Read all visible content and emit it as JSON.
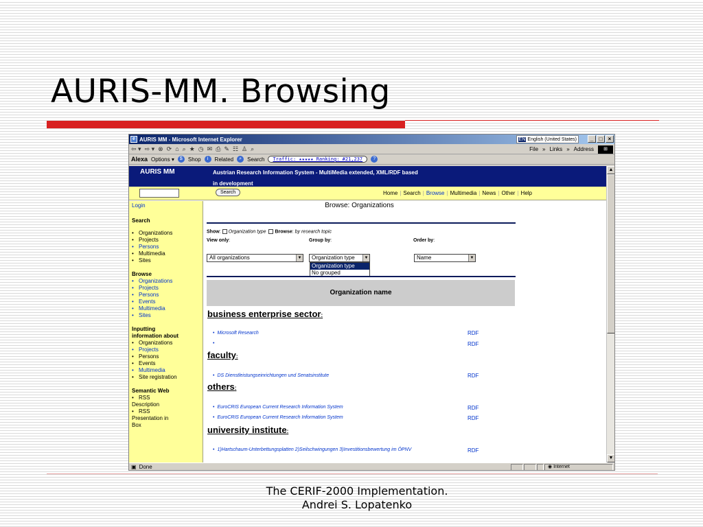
{
  "slide": {
    "title": "AURIS-MM. Browsing",
    "footer_line1": "The CERIF-2000 Implementation.",
    "footer_line2": "Andrei S. Lopatenko"
  },
  "browser": {
    "window_title": "AURIS MM - Microsoft Internet Explorer",
    "language": "English (United States)",
    "language_code": "EN",
    "menu": {
      "file": "File",
      "links": "Links",
      "address": "Address"
    },
    "alexa": {
      "logo": "Alexa",
      "options": "Options",
      "shop": "Shop",
      "related": "Related",
      "search": "Search",
      "traffic": "Traffic: ★★★★★ Ranking: #21,237"
    },
    "status": {
      "text": "Done",
      "zone": "Internet"
    }
  },
  "site": {
    "logo": "AURIS MM",
    "tagline_line1": "Austrian Research Information System - MultiMedia extended, XML/RDF based",
    "tagline_line2": "in development",
    "search_button": "Search",
    "nav_links": [
      "Home",
      "Search",
      "Browse",
      "Multimedia",
      "News",
      "Other",
      "Help"
    ]
  },
  "sidebar": {
    "login": "Login",
    "search_head": "Search",
    "search_items": [
      "Organizations",
      "Projects",
      "Persons",
      "Multimedia",
      "Sites"
    ],
    "browse_head": "Browse",
    "browse_items": [
      "Organizations",
      "Projects",
      "Persons",
      "Events",
      "Multimedia",
      "Sites"
    ],
    "inputting_head_line1": "Inputting",
    "inputting_head_line2": "information about",
    "inputting_items": [
      "Organizations",
      "Projects",
      "Persons",
      "Events",
      "Multimedia",
      "Site registration"
    ],
    "semantic_head": "Semantic Web",
    "semantic_item1_line1": "RSS",
    "semantic_item1_line2": "Description",
    "semantic_item2_line1": "RSS",
    "semantic_item2_line2": "Presentation in",
    "semantic_item2_line3": "Box"
  },
  "main": {
    "title": "Browse: Organizations",
    "show_label": "Show",
    "show_option": "Organization type",
    "browse_label": "Browse",
    "browse_option": "by research topic",
    "view_only_label": "View only",
    "group_by_label": "Group by",
    "order_by_label": "Order by",
    "view_only_value": "All organizations",
    "group_by_value": "Organization type",
    "order_by_value": "Name",
    "group_by_options": [
      "Organization type",
      "No grouped"
    ],
    "org_column_header": "Organization name",
    "rdf_label": "RDF",
    "sectors": [
      {
        "name": "business enterprise sector",
        "orgs": [
          "Microsoft Research",
          ""
        ]
      },
      {
        "name": "faculty",
        "orgs": [
          "DS Dienstleistungseinrichtungen und Senatsinstitute"
        ]
      },
      {
        "name": "others",
        "orgs": [
          "EuroCRIS European Current Research Information System",
          "EuroCRIS European Current Research Information System"
        ]
      },
      {
        "name": "university institute",
        "orgs": [
          "1)Hartschaum-Unterbettungsplatten 2)Seilschwingungen 3)Investitionsbewertung im ÖPNV"
        ]
      }
    ]
  }
}
